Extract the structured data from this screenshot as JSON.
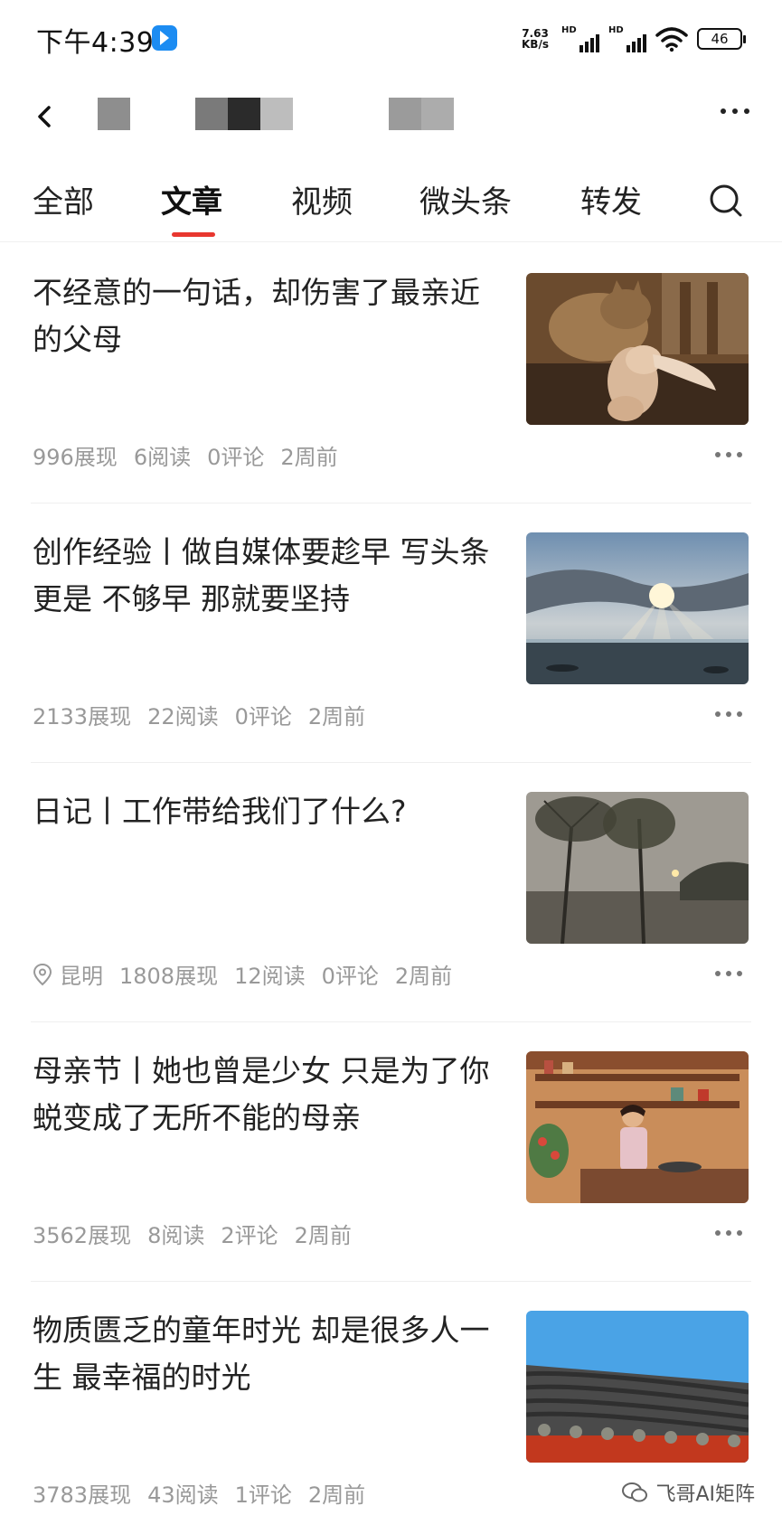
{
  "status_bar": {
    "time": "下午4:39",
    "net_speed_value": "7.63",
    "net_speed_unit": "KB/s",
    "signal_label": "HD",
    "battery": "46"
  },
  "tabs": [
    {
      "label": "全部",
      "active": false
    },
    {
      "label": "文章",
      "active": true
    },
    {
      "label": "视频",
      "active": false
    },
    {
      "label": "微头条",
      "active": false
    },
    {
      "label": "转发",
      "active": false
    }
  ],
  "articles": [
    {
      "title": "不经意的一句话，却伤害了最亲近的父母",
      "location": "",
      "views": "996展现",
      "reads": "6阅读",
      "comments": "0评论",
      "time": "2周前",
      "thumbnail": "cat-and-rabbit-photo"
    },
    {
      "title": "创作经验丨做自媒体要趁早 写头条更是 不够早 那就要坚持",
      "location": "",
      "views": "2133展现",
      "reads": "22阅读",
      "comments": "0评论",
      "time": "2周前",
      "thumbnail": "sunrays-over-lake-photo"
    },
    {
      "title": "日记丨工作带给我们了什么?",
      "location": "昆明",
      "views": "1808展现",
      "reads": "12阅读",
      "comments": "0评论",
      "time": "2周前",
      "thumbnail": "trees-by-lake-photo"
    },
    {
      "title": "母亲节丨她也曾是少女 只是为了你 蜕变成了无所不能的母亲",
      "location": "",
      "views": "3562展现",
      "reads": "8阅读",
      "comments": "2评论",
      "time": "2周前",
      "thumbnail": "woman-cooking-illustration"
    },
    {
      "title": "物质匮乏的童年时光 却是很多人一生 最幸福的时光",
      "location": "",
      "views": "3783展现",
      "reads": "43阅读",
      "comments": "1评论",
      "time": "2周前",
      "thumbnail": "tiled-roof-photo"
    }
  ],
  "watermark": "飞哥AI矩阵"
}
